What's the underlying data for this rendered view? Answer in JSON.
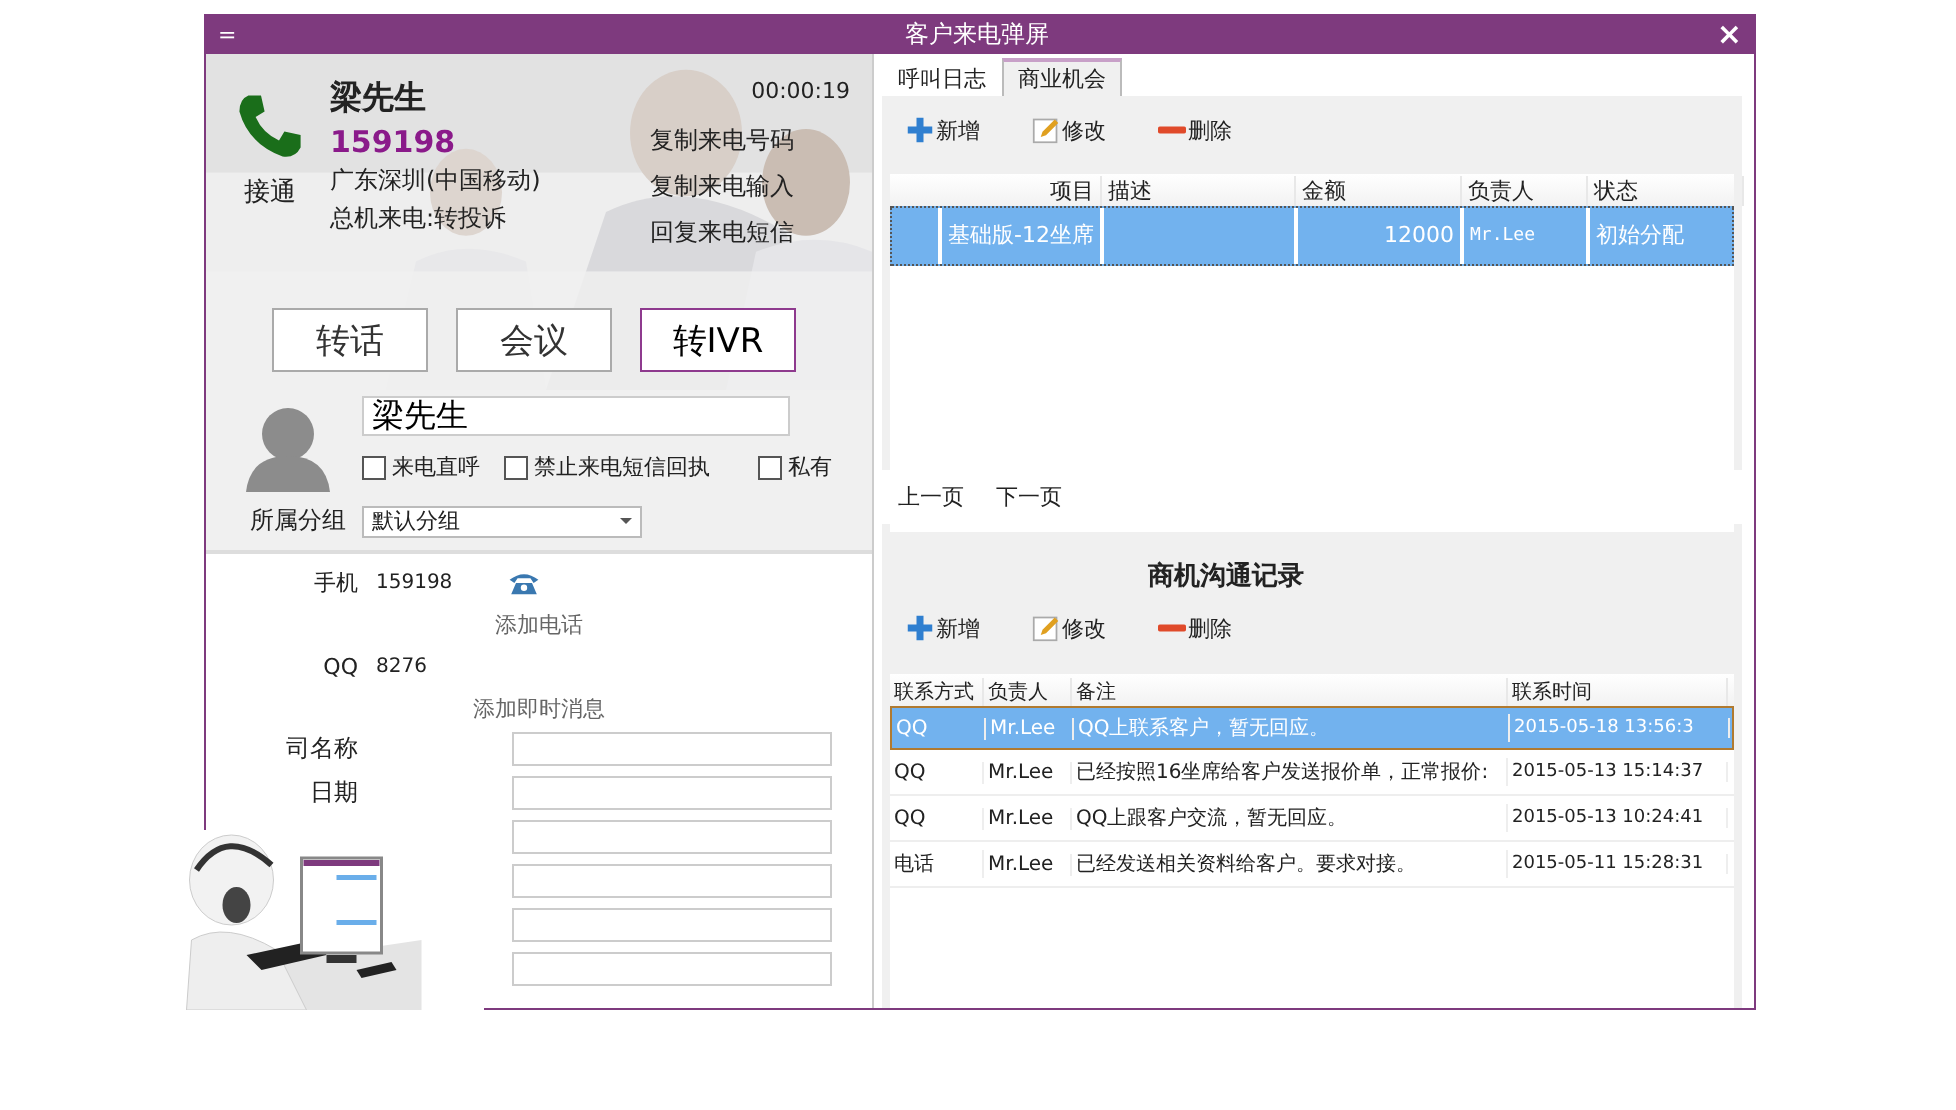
{
  "window": {
    "title": "客户来电弹屏",
    "close": "×",
    "menu": "="
  },
  "caller": {
    "name": "梁先生",
    "phone": "159198",
    "location": "广东深圳(中国移动)",
    "route": "总机来电:转投诉",
    "timer": "00:00:19",
    "answer": "接通",
    "links": [
      "复制来电号码",
      "复制来电输入",
      "回复来电短信"
    ]
  },
  "call_buttons": [
    {
      "label": "转话",
      "selected": false
    },
    {
      "label": "会议",
      "selected": false
    },
    {
      "label": "转IVR",
      "selected": true
    }
  ],
  "contact": {
    "name_value": "梁先生",
    "options": [
      {
        "label": "来电直呼",
        "checked": false
      },
      {
        "label": "禁止来电短信回执",
        "checked": false
      },
      {
        "label": "私有",
        "checked": false
      }
    ],
    "group_label": "所属分组",
    "group_value": "默认分组"
  },
  "details": [
    {
      "kind": "value",
      "label": "手机",
      "value": "159198"
    },
    {
      "kind": "add",
      "label": "添加电话"
    },
    {
      "kind": "value",
      "label": "QQ",
      "value": "8276"
    },
    {
      "kind": "add",
      "label": "添加即时消息"
    }
  ],
  "form_fields": [
    {
      "kind": "labeled",
      "label": "司名称"
    },
    {
      "kind": "labeled",
      "label": "日期"
    },
    {
      "kind": "plain"
    },
    {
      "kind": "plain"
    },
    {
      "kind": "plain"
    },
    {
      "kind": "plain"
    }
  ],
  "tabs": [
    {
      "label": "呼叫日志",
      "selected": false
    },
    {
      "label": "商业机会",
      "selected": true
    }
  ],
  "opportunities": {
    "toolbar": [
      "新增",
      "修改",
      "删除"
    ],
    "columns": [
      "",
      "项目",
      "描述",
      "金额",
      "负责人",
      "状态"
    ],
    "rows": [
      {
        "selected": true,
        "cells": [
          "",
          "基础版-12坐席",
          "",
          "12000",
          "Mr.Lee",
          "初始分配"
        ]
      }
    ],
    "pager": [
      "上一页",
      "下一页"
    ]
  },
  "records": {
    "title": "商机沟通记录",
    "toolbar": [
      "新增",
      "修改",
      "删除"
    ],
    "columns": [
      "联系方式",
      "负责人",
      "备注",
      "联系时间"
    ],
    "rows": [
      {
        "selected": true,
        "cells": [
          "QQ",
          "Mr.Lee",
          "QQ上联系客户，暂无回应。",
          "2015-05-18 13:56:3"
        ]
      },
      {
        "selected": false,
        "cells": [
          "QQ",
          "Mr.Lee",
          "已经按照16坐席给客户发送报价单，正常报价:",
          "2015-05-13 15:14:37"
        ]
      },
      {
        "selected": false,
        "cells": [
          "QQ",
          "Mr.Lee",
          "QQ上跟客户交流，暂无回应。",
          "2015-05-13 10:24:41"
        ]
      },
      {
        "selected": false,
        "cells": [
          "电话",
          "Mr.Lee",
          "已经发送相关资料给客户。要求对接。",
          "2015-05-11 15:28:31"
        ]
      }
    ]
  }
}
